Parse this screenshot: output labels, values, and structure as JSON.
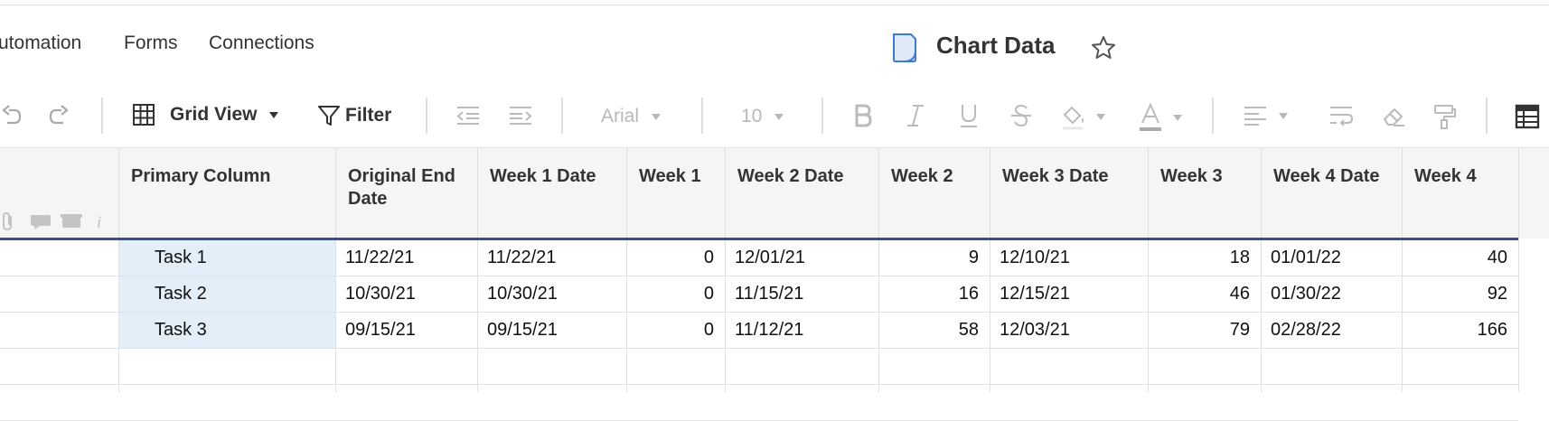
{
  "menu": {
    "items": [
      {
        "label": "utomation"
      },
      {
        "label": "Forms"
      },
      {
        "label": "Connections"
      }
    ]
  },
  "sheet": {
    "title": "Chart Data"
  },
  "toolbar": {
    "view_label": "Grid View",
    "filter_label": "Filter",
    "font_family": "Arial",
    "font_size": "10"
  },
  "grid": {
    "columns": [
      "Primary Column",
      "Original End Date",
      "Week 1 Date",
      "Week 1",
      "Week 2 Date",
      "Week 2",
      "Week 3 Date",
      "Week 3",
      "Week 4 Date",
      "Week 4"
    ],
    "rows": [
      [
        "Task 1",
        "11/22/21",
        "11/22/21",
        "0",
        "12/01/21",
        "9",
        "12/10/21",
        "18",
        "01/01/22",
        "40"
      ],
      [
        "Task 2",
        "10/30/21",
        "10/30/21",
        "0",
        "11/15/21",
        "16",
        "12/15/21",
        "46",
        "01/30/22",
        "92"
      ],
      [
        "Task 3",
        "09/15/21",
        "09/15/21",
        "0",
        "11/12/21",
        "58",
        "12/03/21",
        "79",
        "02/28/22",
        "166"
      ]
    ]
  },
  "colors": {
    "header_underline": "#3b4f8f",
    "primary_highlight": "#e3eef9",
    "header_bg": "#f5f5f3",
    "doc_icon": "#3a7bd5"
  }
}
